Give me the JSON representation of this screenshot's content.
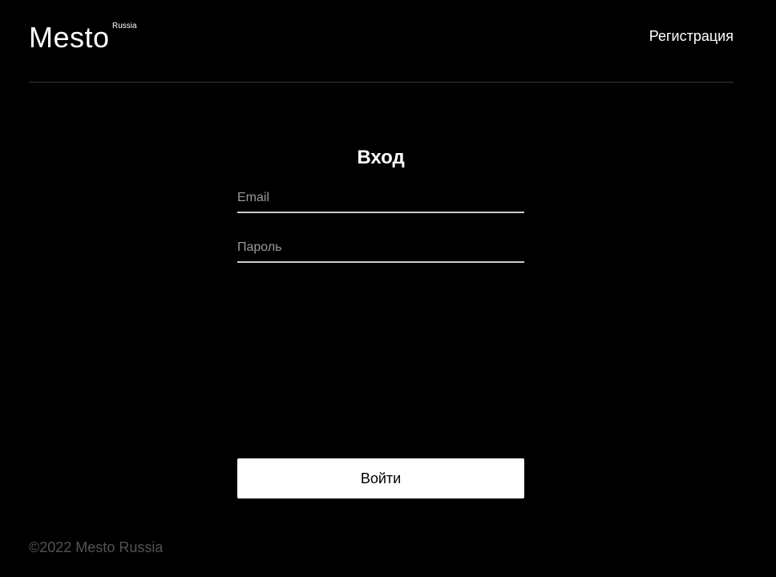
{
  "header": {
    "logo": {
      "main": "Mesto",
      "superscript": "Russia"
    },
    "nav_link": "Регистрация"
  },
  "auth": {
    "title": "Вход",
    "email": {
      "placeholder": "Email",
      "value": ""
    },
    "password": {
      "placeholder": "Пароль",
      "value": ""
    },
    "submit_label": "Войти"
  },
  "footer": {
    "copyright": "©2022 Mesto Russia"
  },
  "colors": {
    "background": "#000000",
    "text": "#ffffff",
    "divider": "#545454",
    "input_underline": "#cccccc",
    "placeholder": "#9a9a9a",
    "footer_text": "#545454",
    "button_bg": "#ffffff",
    "button_text": "#000000"
  }
}
